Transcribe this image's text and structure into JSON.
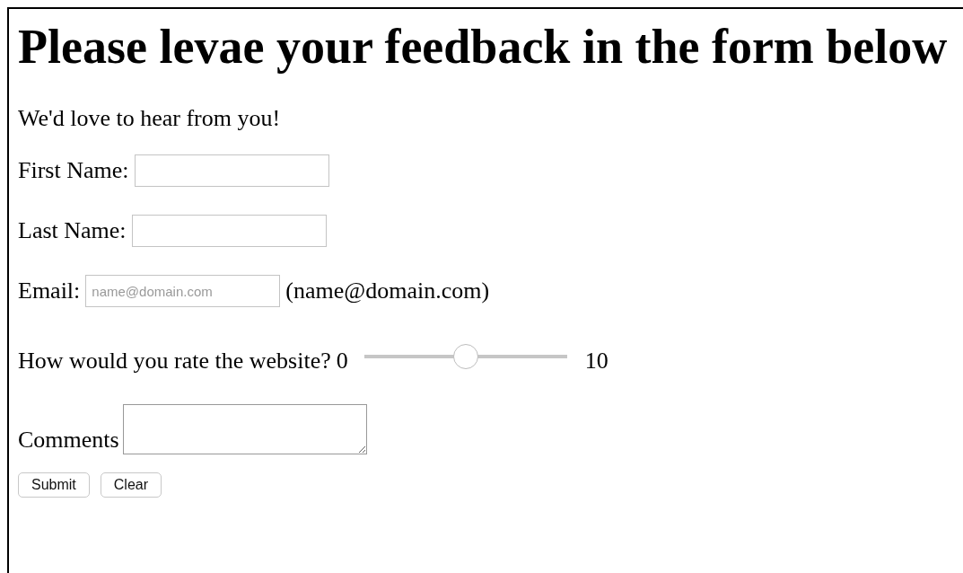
{
  "heading": "Please levae your feedback in the form below",
  "intro": "We'd love to hear from you!",
  "fields": [
    {
      "kind": "text",
      "label": "First Name:"
    },
    {
      "kind": "text",
      "label": "Last Name:"
    },
    {
      "kind": "text",
      "label": "Email:",
      "placeholder": "name@domain.com",
      "hint": "(name@domain.com)"
    },
    {
      "kind": "slider",
      "label": "How would you rate the website?",
      "min_label": "0",
      "max_label": "10",
      "level": 0.5
    },
    {
      "kind": "textarea",
      "label": "Comments"
    }
  ],
  "buttons": [
    "Submit",
    "Clear"
  ]
}
